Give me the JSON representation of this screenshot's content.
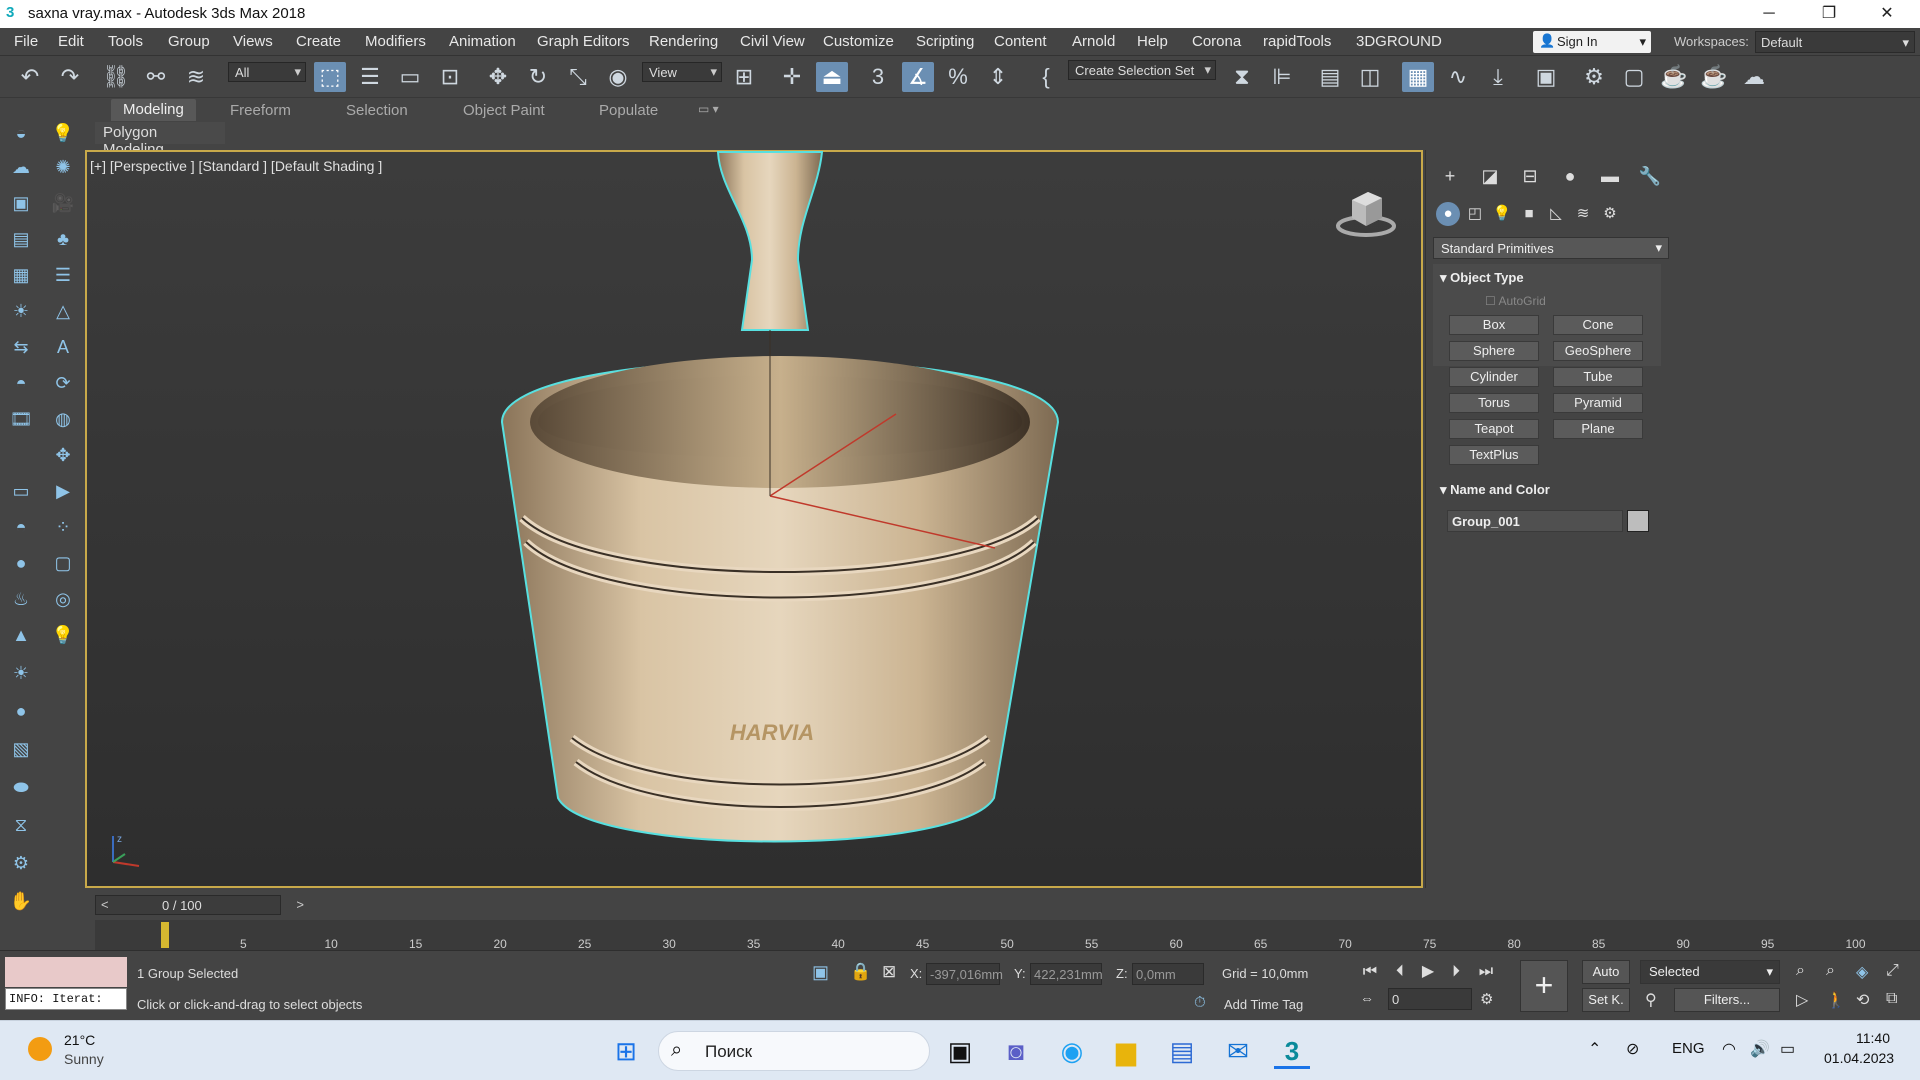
{
  "window": {
    "title": "saxna vray.max - Autodesk 3ds Max 2018",
    "app_icon": "3"
  },
  "menu": [
    "File",
    "Edit",
    "Tools",
    "Group",
    "Views",
    "Create",
    "Modifiers",
    "Animation",
    "Graph Editors",
    "Rendering",
    "Civil View",
    "Customize",
    "Scripting",
    "Content",
    "Arnold",
    "Help",
    "Corona",
    "rapidTools",
    "3DGROUND"
  ],
  "account": {
    "sign_in": "Sign In",
    "workspaces_label": "Workspaces:",
    "workspace": "Default"
  },
  "toolbar": {
    "filter": "All",
    "ref_coord": "View",
    "selection_set": "Create Selection Set"
  },
  "ribbon": {
    "tabs": [
      "Modeling",
      "Freeform",
      "Selection",
      "Object Paint",
      "Populate"
    ],
    "active": "Modeling",
    "panel": "Polygon Modeling"
  },
  "viewport": {
    "label": "[+] [Perspective ] [Standard ] [Default Shading ]",
    "brand_text": "HARVIA",
    "axis_label": "z"
  },
  "command_panel": {
    "category": "Standard Primitives",
    "object_type_title": "Object Type",
    "autogrid": "AutoGrid",
    "primitives": [
      "Box",
      "Cone",
      "Sphere",
      "GeoSphere",
      "Cylinder",
      "Tube",
      "Torus",
      "Pyramid",
      "Teapot",
      "Plane",
      "TextPlus"
    ],
    "name_color_title": "Name and Color",
    "object_name": "Group_001",
    "object_color": "#bdbdbd"
  },
  "timeline": {
    "frame_display": "0 / 100",
    "prev": "<",
    "next": ">",
    "ticks": [
      "5",
      "10",
      "15",
      "20",
      "25",
      "30",
      "35",
      "40",
      "45",
      "50",
      "55",
      "60",
      "65",
      "70",
      "75",
      "80",
      "85",
      "90",
      "95",
      "100"
    ]
  },
  "status": {
    "selection": "1 Group Selected",
    "prompt": "Click or click-and-drag to select objects",
    "info": "INFO: Iterat:",
    "x_label": "X:",
    "x_value": "-397,016mm",
    "y_label": "Y:",
    "y_value": "422,231mm",
    "z_label": "Z:",
    "z_value": "0,0mm",
    "grid": "Grid = 10,0mm",
    "add_time_tag": "Add Time Tag",
    "auto": "Auto",
    "set_key": "Set K.",
    "key_mode": "Selected",
    "filters": "Filters...",
    "frame": "0"
  },
  "taskbar": {
    "weather_temp": "21°C",
    "weather_desc": "Sunny",
    "search": "Поиск",
    "lang": "ENG",
    "time": "11:40",
    "date": "01.04.2023"
  }
}
